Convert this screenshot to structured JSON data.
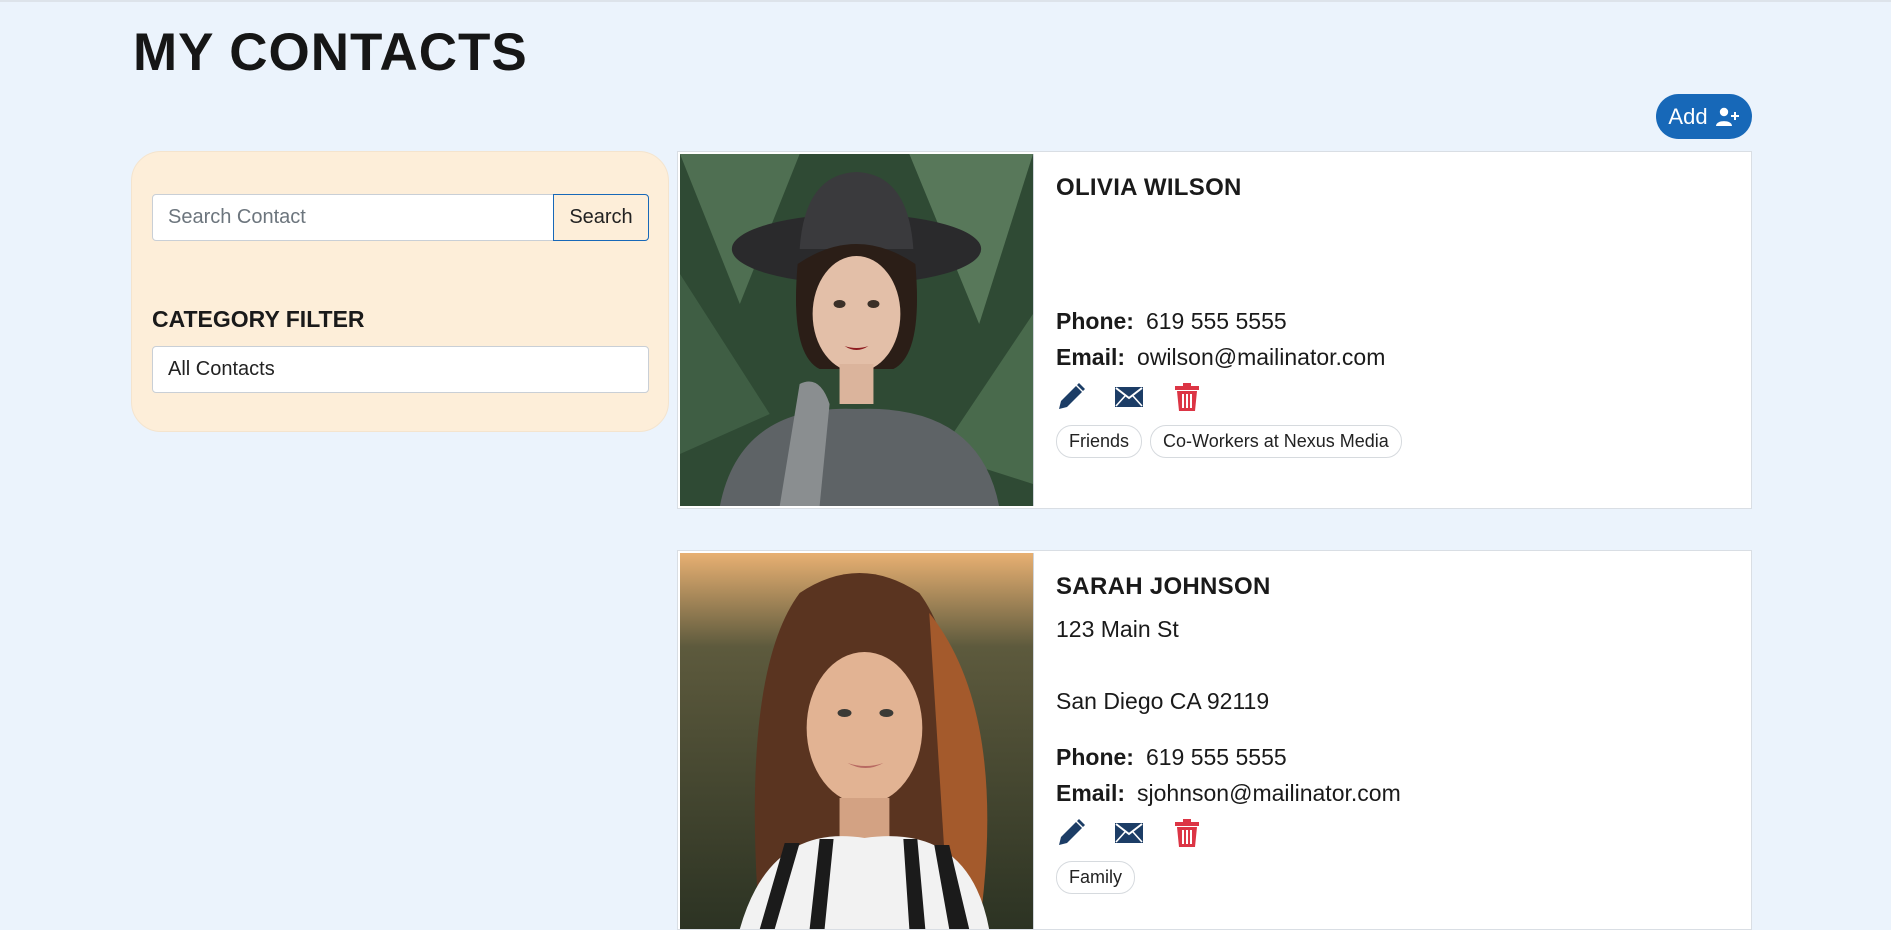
{
  "page": {
    "title": "MY CONTACTS"
  },
  "toolbar": {
    "add_label": "Add"
  },
  "sidebar": {
    "search_placeholder": "Search Contact",
    "search_button": "Search",
    "filter_heading": "CATEGORY FILTER",
    "filter_selected": "All Contacts"
  },
  "contacts": [
    {
      "name": "OLIVIA WILSON",
      "phone_label": "Phone:",
      "phone": "619 555 5555",
      "email_label": "Email:",
      "email": "owilson@mailinator.com",
      "tags": [
        "Friends",
        "Co-Workers at Nexus Media"
      ]
    },
    {
      "name": "SARAH JOHNSON",
      "address_line1": "123 Main St",
      "address_line2": "San Diego CA 92119",
      "phone_label": "Phone:",
      "phone": "619 555 5555",
      "email_label": "Email:",
      "email": "sjohnson@mailinator.com",
      "tags": [
        "Family"
      ]
    }
  ],
  "colors": {
    "background": "#ebf3fc",
    "sidebar": "#fdeed9",
    "primary": "#1768b8",
    "icon": "#1c3d66",
    "delete": "#dc3545"
  },
  "icons": {
    "add": "user-plus-icon",
    "edit": "pencil-icon",
    "email": "envelope-icon",
    "delete": "trash-icon"
  }
}
